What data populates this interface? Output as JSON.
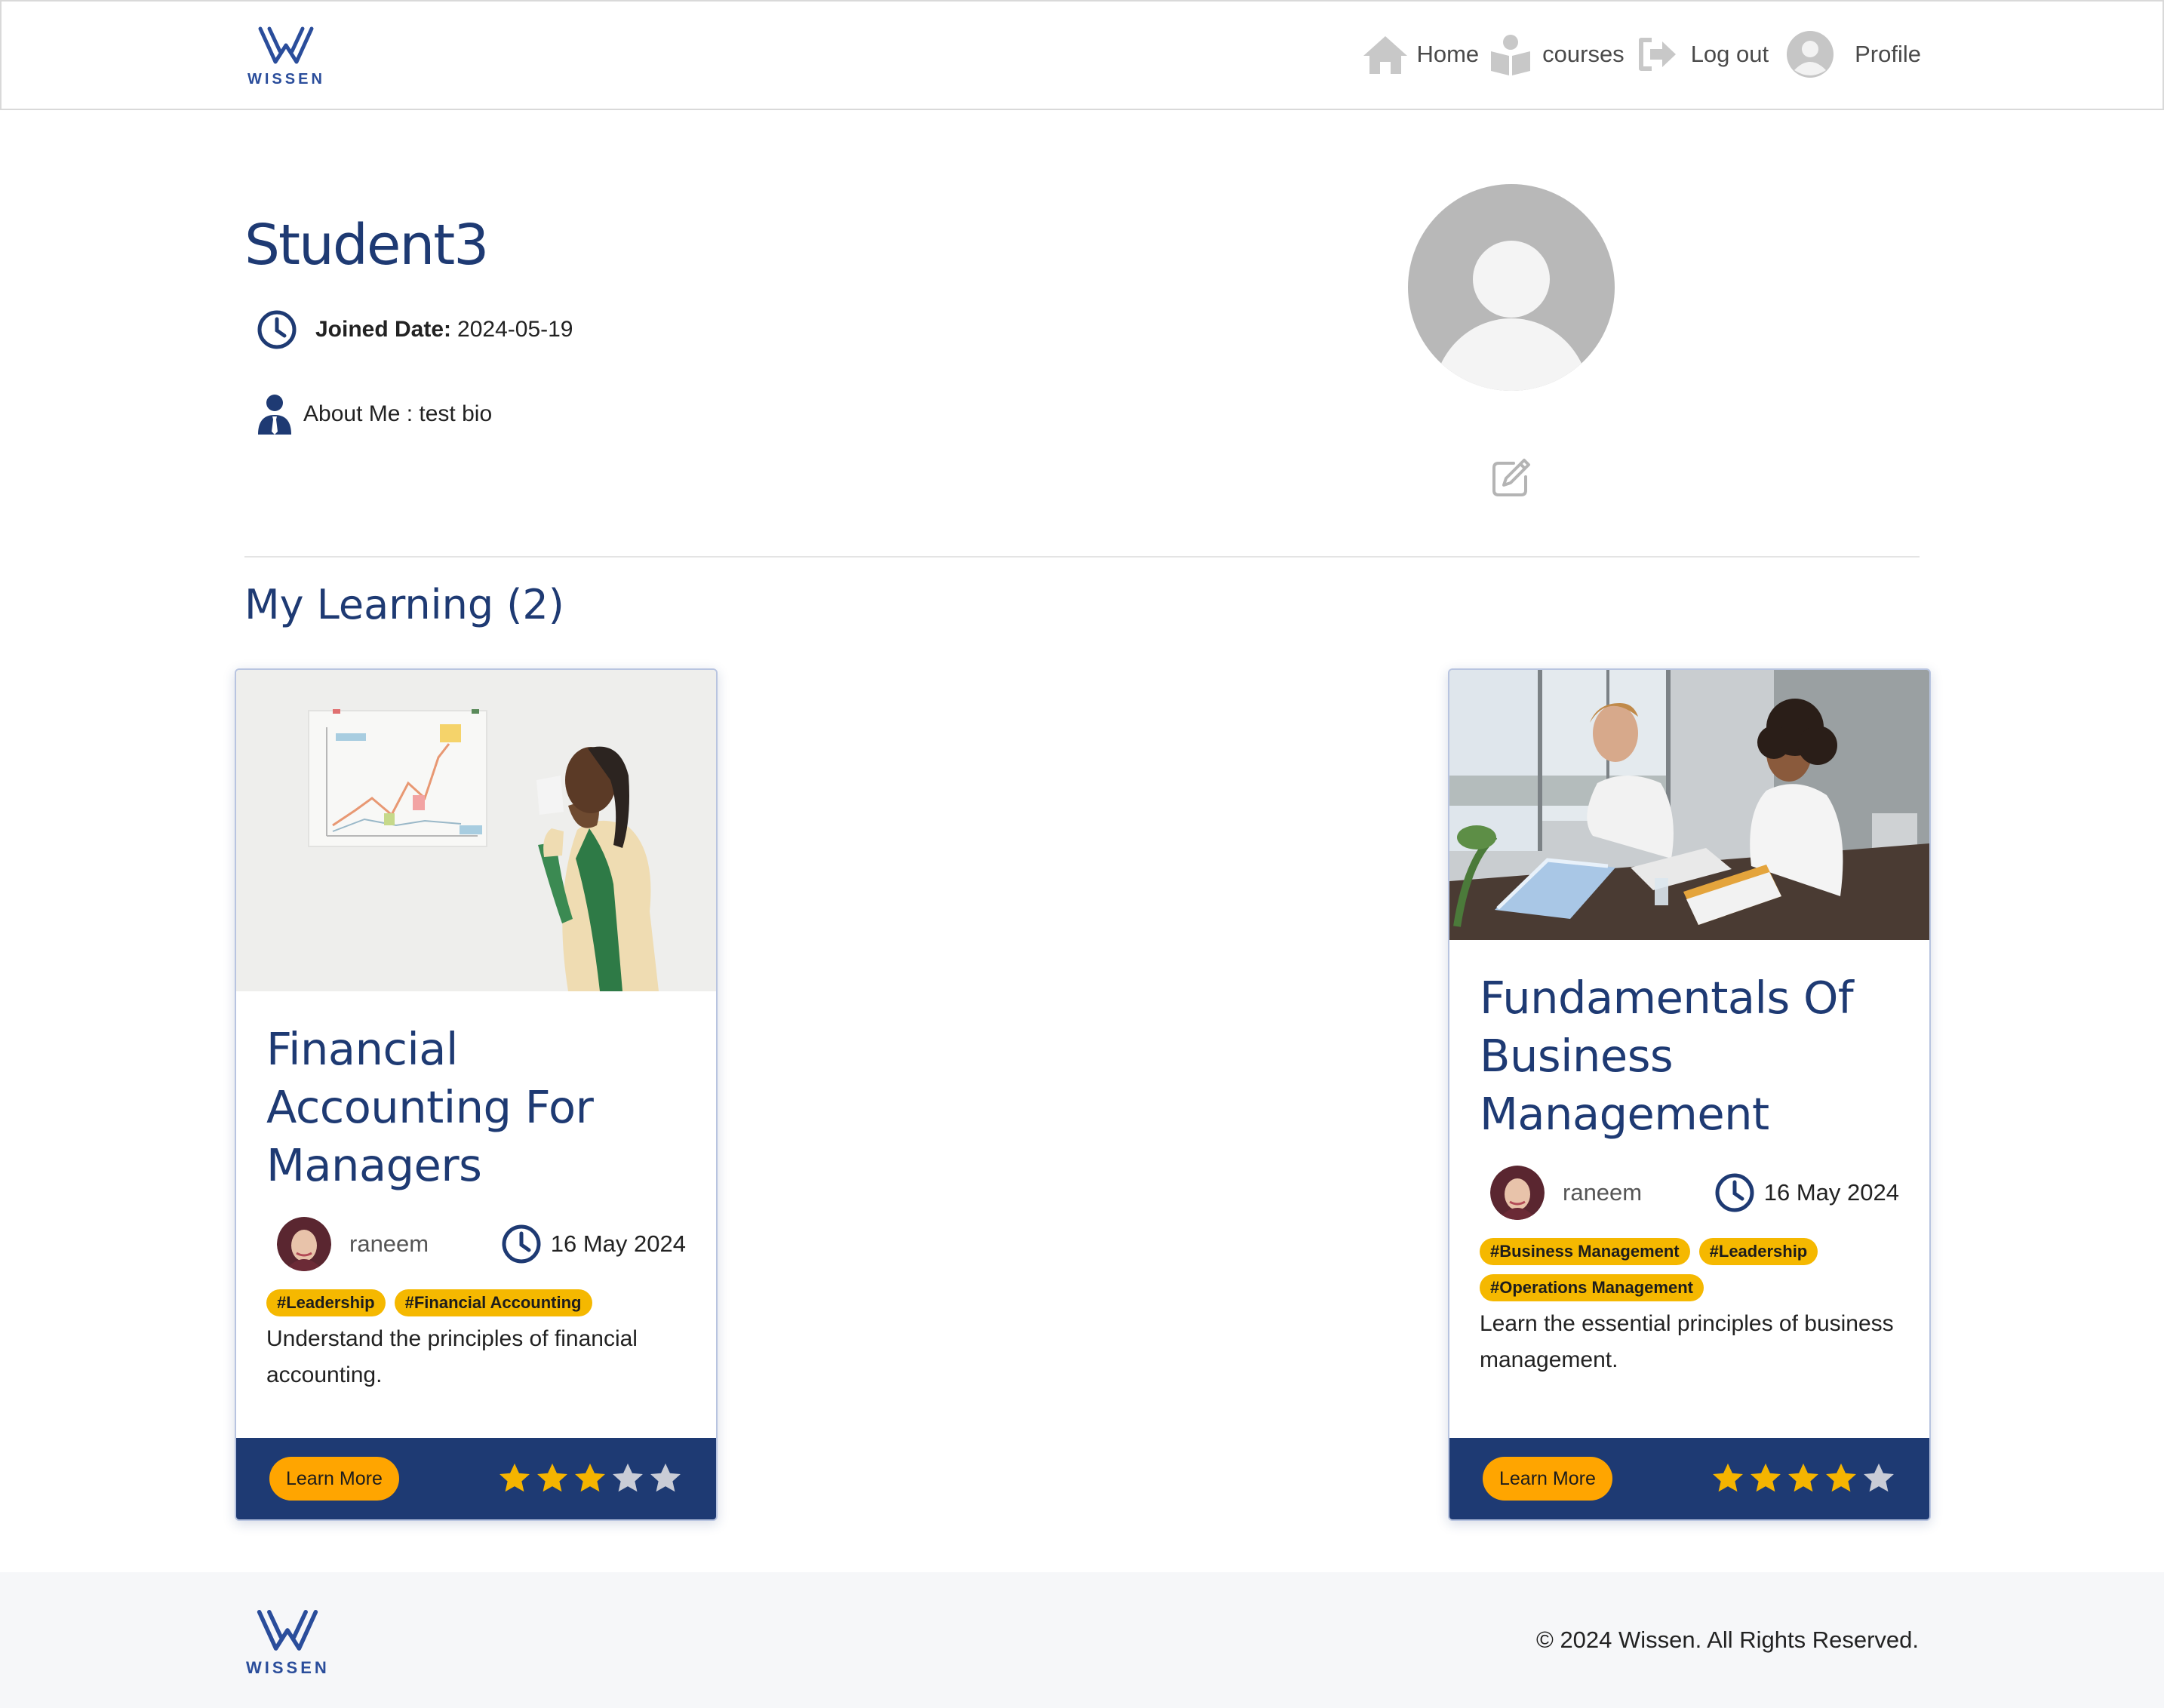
{
  "brand": {
    "name": "WISSEN",
    "color": "#2a4d9b"
  },
  "nav": {
    "items": [
      {
        "label": "Home",
        "icon": "home-icon"
      },
      {
        "label": "courses",
        "icon": "book-reader-icon"
      },
      {
        "label": "Log out",
        "icon": "logout-icon"
      },
      {
        "label": "Profile",
        "icon": "user-avatar-icon"
      }
    ]
  },
  "profile": {
    "name": "Student3",
    "joined_label": "Joined Date:",
    "joined_value": "2024-05-19",
    "about": "About Me : test bio",
    "avatar_icon": "default-avatar-icon",
    "edit_icon": "edit-icon"
  },
  "learning": {
    "title": "My Learning (2)",
    "courses": [
      {
        "title": "Financial Accounting For Managers",
        "author": "raneem",
        "date": "16 May 2024",
        "tags": [
          "#Leadership",
          "#Financial Accounting"
        ],
        "description": "Understand the principles of financial accounting.",
        "button": "Learn More",
        "rating": 3,
        "rating_max": 5,
        "image": "woman drinking coffee next to chart on wall"
      },
      {
        "title": "Fundamentals Of Business Management",
        "author": "raneem",
        "date": "16 May 2024",
        "tags": [
          "#Business Management",
          "#Leadership",
          "#Operations Management"
        ],
        "description": "Learn the essential principles of business management.",
        "button": "Learn More",
        "rating": 4,
        "rating_max": 5,
        "image": "two colleagues reviewing documents at office table"
      }
    ]
  },
  "footer": {
    "copyright": "© 2024 Wissen. All Rights Reserved."
  },
  "colors": {
    "primary": "#1e3a73",
    "accent": "#ffa500",
    "tag": "#f5b800",
    "star_on": "#f5b400",
    "star_off": "#c9ccd6"
  }
}
